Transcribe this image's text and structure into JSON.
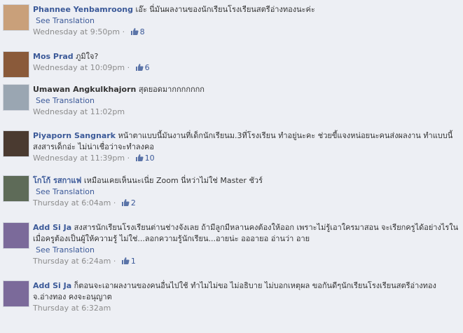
{
  "comments": [
    {
      "name": "Phannee Yenbamroong",
      "text": "เอ๊ะ นี่มันผลงานของนักเรียนโรงเรียนสตรีอ่างทองนะค่ะ",
      "see_translation": "See Translation",
      "time": "Wednesday at 9:50pm",
      "sep": " · ",
      "likes": "8",
      "avatar_color": "#c9a07a"
    },
    {
      "name": "Mos Prad",
      "text": "ภูมิใจ?",
      "see_translation": "",
      "time": "Wednesday at 10:09pm",
      "sep": " · ",
      "likes": "6",
      "avatar_color": "#8a5a3a"
    },
    {
      "name": "Umawan Angkulkhajorn",
      "text": "สุดยอดมากกกกกกก",
      "see_translation": "See Translation",
      "time": "Wednesday at 11:02pm",
      "sep": "",
      "likes": "",
      "avatar_color": "#9aa6b2"
    },
    {
      "name": "Piyaporn Sangnark",
      "text": "หน้าตาแบบนี้มันงานที่เด็กนักเรียนม.3ที่โรงเรียน ทำอยู่นะคะ ช่วยขี้แจงหน่อยนะคนส่งผลงาน ทำแบบนี้สงสารเด็กอ่ะ ไม่น่าเชื่อว่าจะทำลงคอ",
      "see_translation": "",
      "time": "Wednesday at 11:39pm",
      "sep": " · ",
      "likes": "10",
      "avatar_color": "#4a3a30"
    },
    {
      "name": "โกโก้ รสกาแฟ",
      "text": "เหมือนเคยเห็นนะเนี่ย Zoom นี่หว่าไม่ใช่ Master ชัวร์",
      "see_translation": "See Translation",
      "time": "Thursday at 6:04am",
      "sep": " · ",
      "likes": "2",
      "avatar_color": "#5e6b58"
    },
    {
      "name": "Add Si Ja",
      "text": "สงสารนักเรียนโรงเรียนต่านช่างจังเลย ถ้ามีลูกมีหลานคงต้องให้ออก เพราะไม่รู้เอาใครมาสอน จะเรียกครูได้อย่างไรในเมื่อครูต้องเป็นผู้ให้ความรู้ ไม่ใช่...ลอกความรู้นักเรียน...อายน่ะ อออายอ อ่านว่า อาย",
      "see_translation": "See Translation",
      "time": "Thursday at 6:24am",
      "sep": " · ",
      "likes": "1",
      "avatar_color": "#7b6a9a"
    },
    {
      "name": "Add Si Ja",
      "text": "ก็ตอนจะเอาผลงานของคนอื่นไปใช้ ทำไมไม่ขอ ไม่อธิบาย ไม่บอกเหตุผล ขอกันดีๆนักเรียนโรงเรียนสตรีอ่างทอง จ.อ่างทอง คงจะอนุญาต",
      "see_translation": "",
      "time": "Thursday at 6:32am",
      "sep": "",
      "likes": "",
      "avatar_color": "#7b6a9a"
    }
  ]
}
